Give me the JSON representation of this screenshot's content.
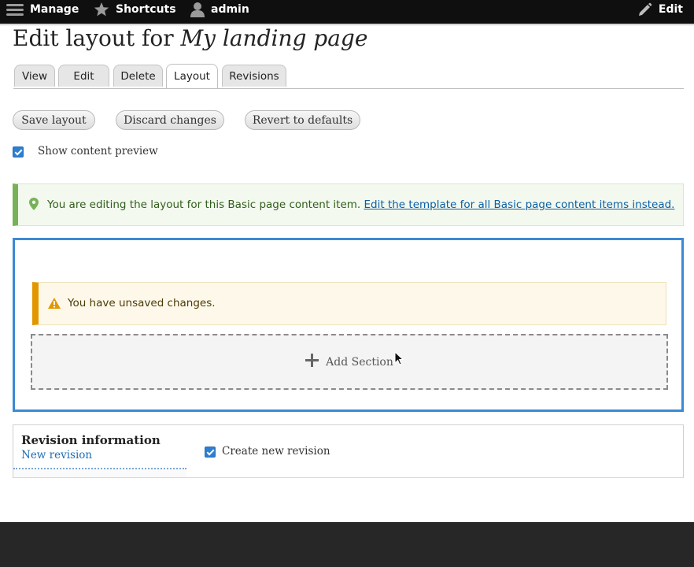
{
  "toolbar": {
    "manage_label": "Manage",
    "shortcuts_label": "Shortcuts",
    "user_label": "admin",
    "edit_label": "Edit"
  },
  "page": {
    "title_prefix": "Edit layout for ",
    "title_entity": "My landing page"
  },
  "tabs": [
    {
      "label": "View",
      "active": false
    },
    {
      "label": "Edit",
      "active": false
    },
    {
      "label": "Delete",
      "active": false
    },
    {
      "label": "Layout",
      "active": true
    },
    {
      "label": "Revisions",
      "active": false
    }
  ],
  "actions": {
    "save_label": "Save layout",
    "discard_label": "Discard changes",
    "revert_label": "Revert to defaults"
  },
  "preview": {
    "label": "Show content preview",
    "checked": true
  },
  "status_message": {
    "text": "You are editing the layout for this Basic page content item.",
    "link_text": "Edit the template for all Basic page content items instead."
  },
  "warning_message": {
    "text": "You have unsaved changes."
  },
  "layout_builder": {
    "add_section_label": "Add Section"
  },
  "revision": {
    "title": "Revision information",
    "subtitle": "New revision",
    "checkbox_label": "Create new revision",
    "checked": true
  },
  "colors": {
    "toolbar_bg": "#0f0f0f",
    "status_border": "#77b259",
    "warning_border": "#e29700",
    "builder_border": "#3b8ad3",
    "link": "#0b5fa5",
    "checkbox": "#2d7fd2",
    "footer_bg": "#272727"
  },
  "icons": {
    "manage": "hamburger-icon",
    "shortcuts": "star-icon",
    "user": "user-icon",
    "edit": "pencil-icon",
    "status": "map-pin-icon",
    "warning": "warning-icon",
    "add_section": "plus-icon",
    "cursor": "mouse-pointer-icon"
  }
}
